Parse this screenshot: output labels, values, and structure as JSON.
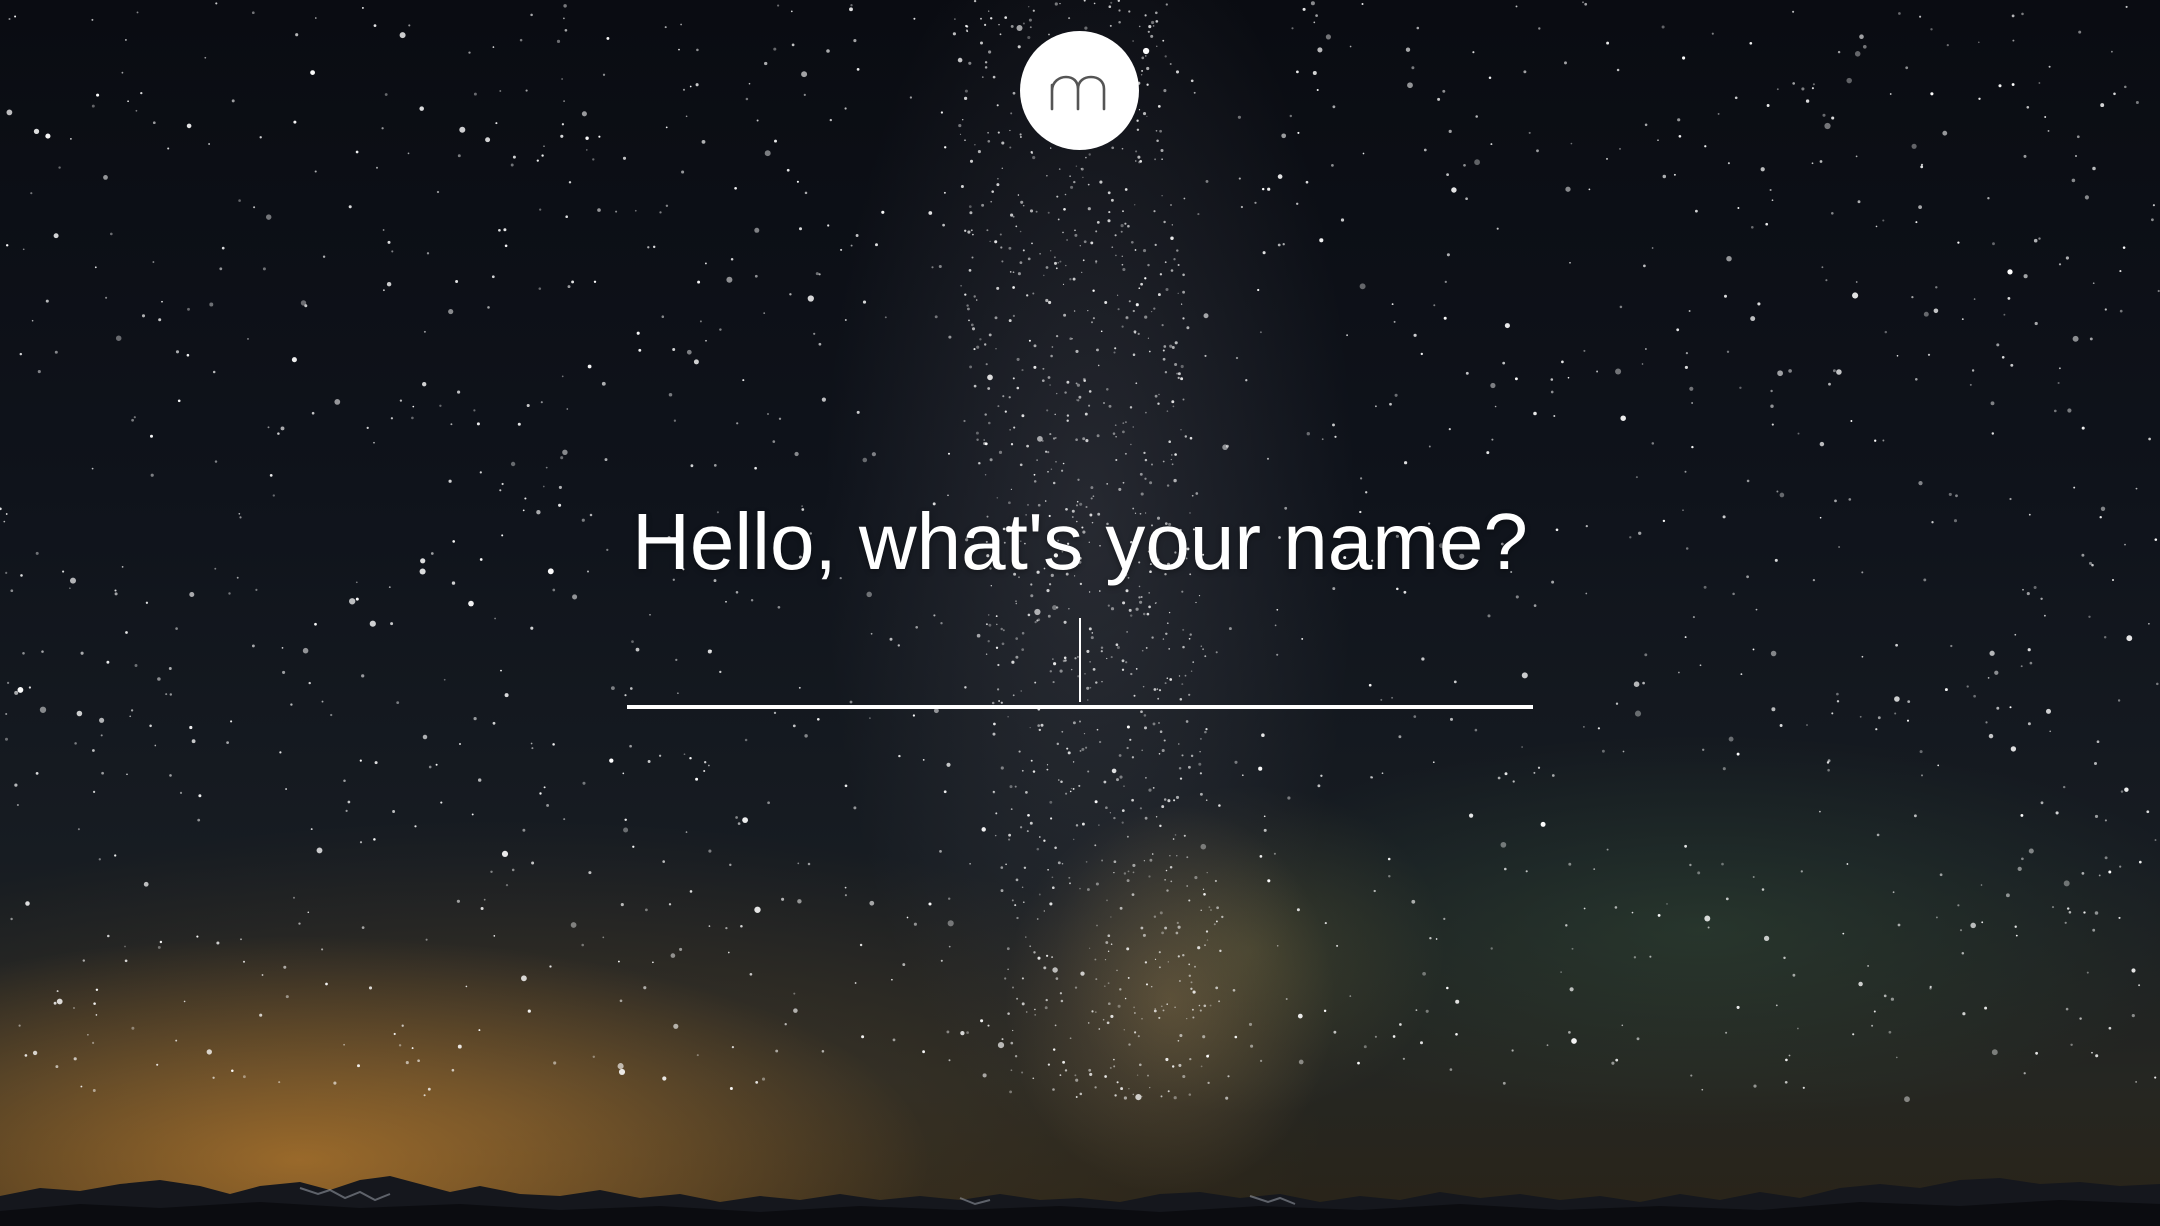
{
  "app": {
    "logo_letter": "m",
    "logo_icon": "m-logo-icon"
  },
  "greeting": {
    "prompt": "Hello, what's your name?"
  },
  "name_input": {
    "value": "",
    "placeholder": ""
  },
  "colors": {
    "text": "#ffffff",
    "logo_bg": "#ffffff",
    "logo_glyph": "#555555"
  }
}
